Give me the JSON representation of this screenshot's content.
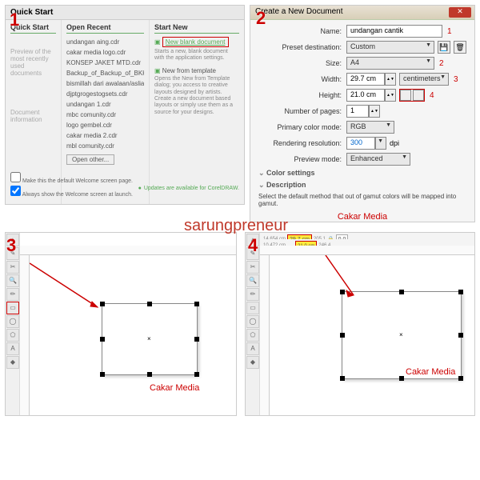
{
  "step_numbers": [
    "1",
    "2",
    "3",
    "4"
  ],
  "watermark": "sarungpreneur",
  "panel1": {
    "title": "Quick Start",
    "sidebar_quick": "Quick Start",
    "sidebar_preview": "Preview of the most recently used documents",
    "sidebar_docinfo": "Document information",
    "col2_head": "Open Recent",
    "recent": [
      "undangan aing.cdr",
      "cakar media logo.cdr",
      "KONSEP JAKET MTD.cdr",
      "Backup_of_Backup_of_BKK...",
      "bismillah dari awalaan/aslia...",
      "djptgrogestogsets.cdr",
      "undangan 1.cdr",
      "mbc comunity.cdr",
      "logo gembel.cdr",
      "cakar media 2.cdr",
      "mbl comunity.cdr"
    ],
    "open_other": "Open other...",
    "col3_head": "Start New",
    "new_blank": "New blank document",
    "new_blank_desc": "Starts a new, blank document with the application settings.",
    "new_template": "New from template",
    "new_template_desc": "Opens the New from Template dialog; you access to creative layouts designed by artists. Create a new document based layouts or simply use them as a source for your designs.",
    "footer_check1": "Make this the default Welcome screen page.",
    "footer_check2": "Always show the Welcome screen at launch.",
    "update": "Updates are available for CorelDRAW."
  },
  "panel2": {
    "dialog_title": "Create a New Document",
    "labels": {
      "name": "Name:",
      "preset": "Preset destination:",
      "size": "Size:",
      "width": "Width:",
      "height": "Height:",
      "pages": "Number of pages:",
      "colormode": "Primary color mode:",
      "resolution": "Rendering resolution:",
      "preview": "Preview mode:"
    },
    "values": {
      "name": "undangan cantik",
      "preset": "Custom",
      "size": "A4",
      "width": "29.7 cm",
      "height": "21.0 cm",
      "units": "centimeters",
      "pages": "1",
      "colormode": "RGB",
      "resolution": "300",
      "dpi": "dpi",
      "preview": "Enhanced"
    },
    "callouts": [
      "1",
      "2",
      "3",
      "4"
    ],
    "section_color": "Color settings",
    "section_desc": "Description",
    "desc_text": "Select the default method that out of gamut colors will be mapped into gamut.",
    "cakar": "Cakar Media"
  },
  "panel3": {
    "cakar": "Cakar Media"
  },
  "panel4": {
    "topbar": {
      "x": "14.654 cm",
      "y": "10.472 cm",
      "w": "29.7 cm",
      "h": "21.0 cm",
      "scale_x": "205.1",
      "scale_y": "246.4",
      "rot": "0.0"
    },
    "cakar": "Cakar Media"
  }
}
